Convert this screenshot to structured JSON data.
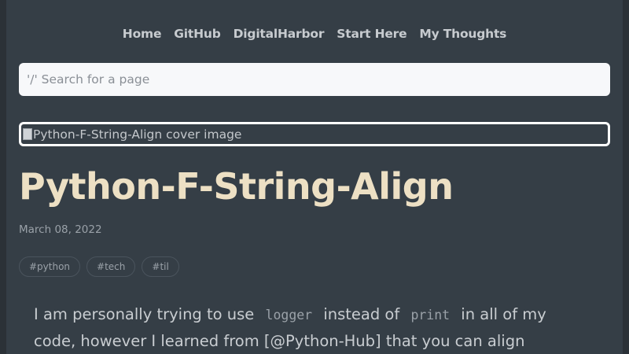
{
  "nav": {
    "items": [
      "Home",
      "GitHub",
      "DigitalHarbor",
      "Start Here",
      "My Thoughts"
    ]
  },
  "search": {
    "placeholder": "'/' Search for a page"
  },
  "cover": {
    "alt": "Python-F-String-Align cover image"
  },
  "post": {
    "title": "Python-F-String-Align",
    "date": "March 08, 2022",
    "tags": [
      "#python",
      "#tech",
      "#til"
    ],
    "body": {
      "part1": "I am personally trying to use ",
      "code1": "logger",
      "part2": " instead of ",
      "code2": "print",
      "part3": " in all of my code, however I learned from [@Python-Hub] that you can align"
    }
  },
  "colors": {
    "background": "#353e46",
    "title": "#ede0c4",
    "nav_text": "#c7cbcf",
    "search_bg": "#f7f8fa"
  }
}
